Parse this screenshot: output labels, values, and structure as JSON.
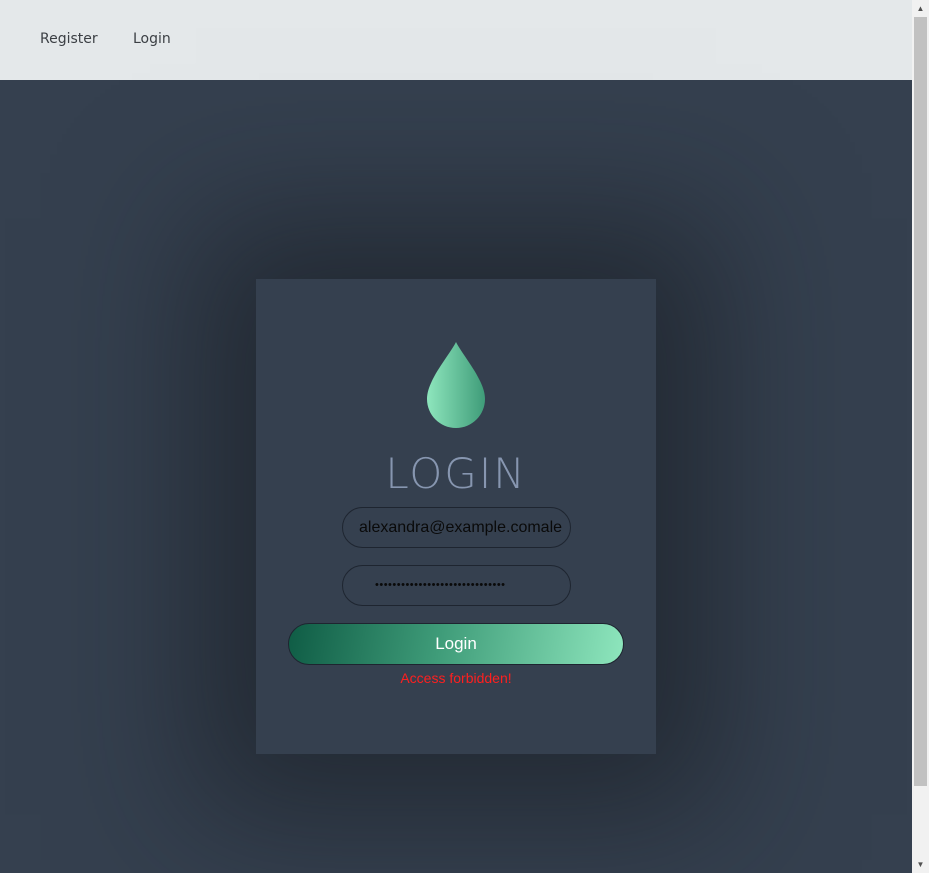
{
  "nav": {
    "register_label": "Register",
    "login_label": "Login"
  },
  "card": {
    "logo_icon": "drop-icon",
    "title": "LOGIN",
    "email_value": "alexandra@example.comale",
    "password_value": "••••••••••••••••••••••••••••••",
    "button_label": "Login",
    "error_text": "Access forbidden!"
  },
  "colors": {
    "background": "#35404f",
    "navbar": "#e4e8ea",
    "accent_dark": "#0f5c45",
    "accent_light": "#8ee6bd",
    "error": "#ff1f1f",
    "title": "#8796b0"
  }
}
